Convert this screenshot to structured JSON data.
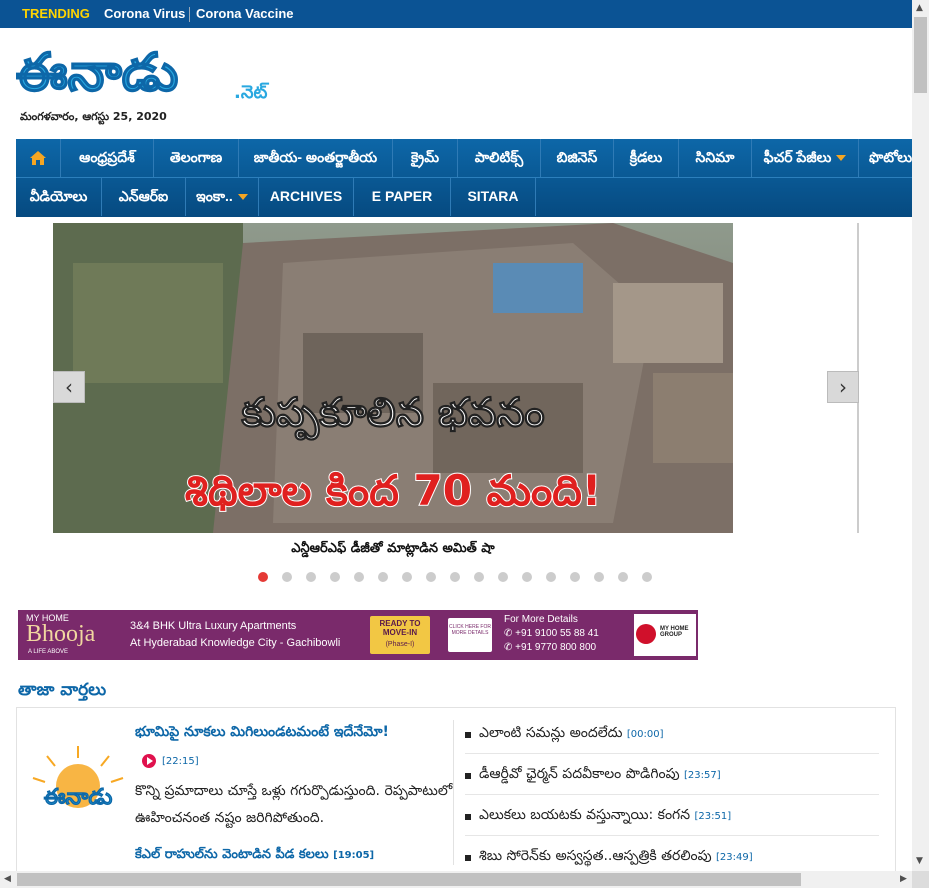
{
  "trending": {
    "label": "TRENDING",
    "items": [
      "Corona Virus",
      "Corona Vaccine"
    ]
  },
  "logo": {
    "text": "ఈనాడు",
    "suffix": ".నెట్"
  },
  "date": "మంగళవారం, ఆగస్టు 25, 2020",
  "nav": {
    "row1": [
      "ఆంధ్రప్రదేశ్",
      "తెలంగాణ",
      "జాతీయ- అంతర్జాతీయ",
      "క్రైమ్",
      "పాలిటిక్స్",
      "బిజినెస్",
      "క్రీడలు",
      "సినిమా",
      "ఫీచర్ పేజీలు",
      "ఫొటోలు"
    ],
    "row2": [
      "వీడియోలు",
      "ఎన్ఆర్ఐ",
      "ఇంకా..",
      "ARCHIVES",
      "E PAPER",
      "SITARA"
    ]
  },
  "slider": {
    "headline1": "కుప్పకూలిన భవనం",
    "headline2": "శిథిలాల కింద 70 మంది!",
    "caption": "ఎన్డీఆర్ఎఫ్ డీజీతో మాట్లాడిన అమిత్ షా",
    "prev": "‹",
    "next": "›",
    "dots": 17,
    "active_dot": 0
  },
  "ad": {
    "brand": "MY HOME",
    "name": "Bhooja",
    "tag": "A LIFE ABOVE",
    "line1": "3&4 BHK Ultra Luxury Apartments",
    "line2": "At Hyderabad Knowledge City - Gachibowli",
    "badge1": "READY TO MOVE-IN",
    "badge1_sub": "(Phase-I)",
    "badge2": "CLICK HERE FOR MORE DETAILS",
    "details": "For More Details",
    "phone1": "+91 9100 55 88 41",
    "phone2": "+91 9770 800 800",
    "group": "MY HOME GROUP"
  },
  "latest": {
    "title": "తాజా వార్తలు",
    "lead_title": "భూమిపై నూకలు మిగిలుండటమంటే ఇదేనేమో!",
    "lead_time": "[22:15]",
    "summary": "కొన్ని ప్రమాదాలు చూస్తే ఒళ్లు గగుర్పొడుస్తుంది. రెప్పపాటులో ఊహించనంత నష్టం జరిగిపోతుంది.",
    "sub_title": "కేఎల్ రాహుల్‌ను వెంటాడిన పీడ కలలు",
    "sub_time": "[19:05]",
    "items": [
      {
        "text": "ఎలాంటి సమన్లు అందలేదు",
        "time": "[00:00]"
      },
      {
        "text": "డీఆర్డీవో ఛైర్మన్ పదవీకాలం పొడిగింపు",
        "time": "[23:57]"
      },
      {
        "text": "ఎలుకలు బయటకు వస్తున్నాయి: కంగన",
        "time": "[23:51]"
      },
      {
        "text": "శిబు సోరెన్‌కు అస్వస్థత..ఆస్పత్రికి తరలింపు",
        "time": "[23:49]"
      }
    ]
  },
  "colors": {
    "brand_blue": "#0d67a8",
    "trending_yellow": "#ffd400",
    "headline_red": "#e0201f",
    "ad_purple": "#7a2a6b"
  }
}
